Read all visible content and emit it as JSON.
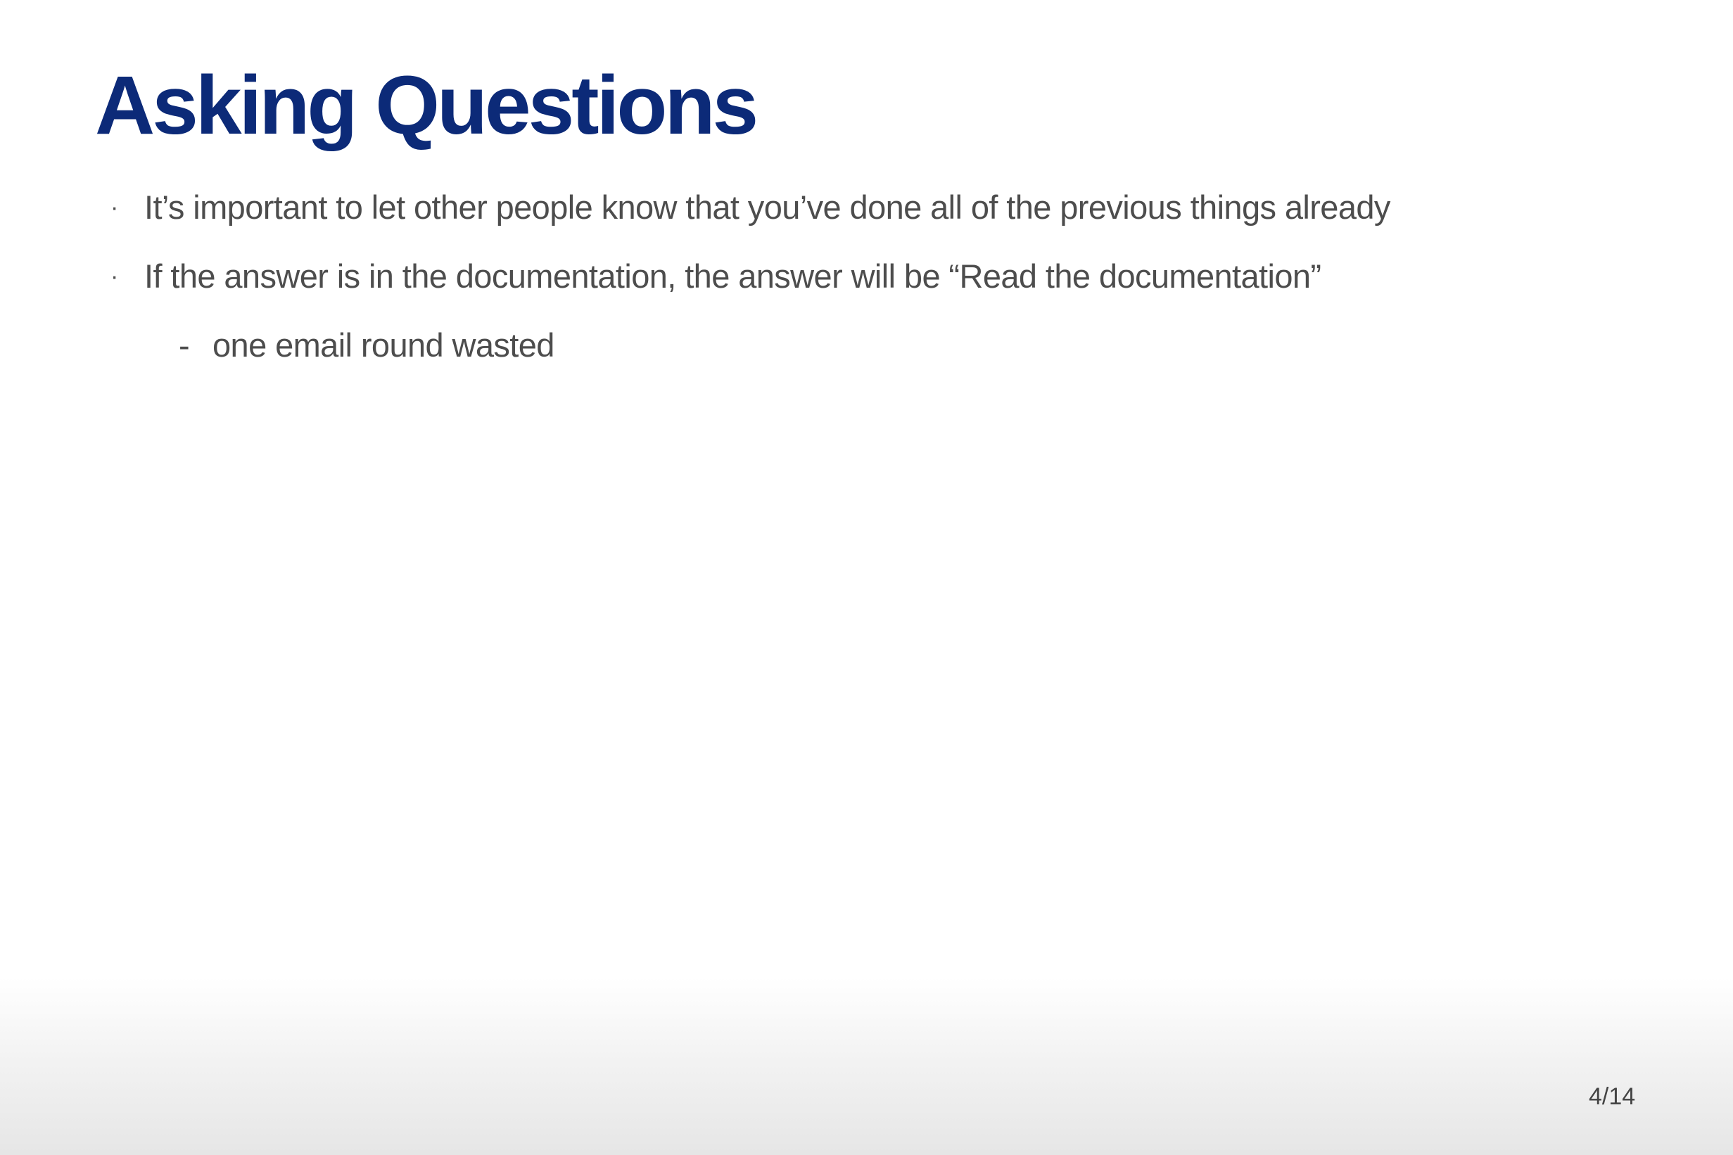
{
  "slide": {
    "title": "Asking Questions",
    "bullets": [
      {
        "marker": "·",
        "text": "It’s important to let other people know that you’ve done all of the previous things already"
      },
      {
        "marker": "·",
        "text": "If the answer is in the documentation, the answer will be “Read the documentation”"
      }
    ],
    "sub_bullets": [
      {
        "marker": "-",
        "text": "one email round wasted"
      }
    ],
    "page_number": "4/14"
  },
  "colors": {
    "title": "#0c2a78",
    "body_text": "#4d4d4d",
    "page_number": "#444444",
    "background": "#ffffff",
    "footer_gradient_end": "#e6e6e6"
  }
}
